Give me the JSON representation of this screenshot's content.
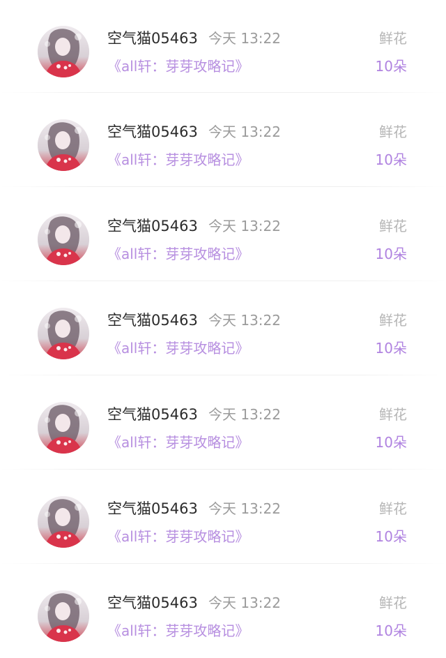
{
  "gift_records": [
    {
      "user": "空气猫05463",
      "time": "今天 13:22",
      "gift_type": "鲜花",
      "book": "《all轩：芽芽攻略记》",
      "count": "10朵"
    },
    {
      "user": "空气猫05463",
      "time": "今天 13:22",
      "gift_type": "鲜花",
      "book": "《all轩：芽芽攻略记》",
      "count": "10朵"
    },
    {
      "user": "空气猫05463",
      "time": "今天 13:22",
      "gift_type": "鲜花",
      "book": "《all轩：芽芽攻略记》",
      "count": "10朵"
    },
    {
      "user": "空气猫05463",
      "time": "今天 13:22",
      "gift_type": "鲜花",
      "book": "《all轩：芽芽攻略记》",
      "count": "10朵"
    },
    {
      "user": "空气猫05463",
      "time": "今天 13:22",
      "gift_type": "鲜花",
      "book": "《all轩：芽芽攻略记》",
      "count": "10朵"
    },
    {
      "user": "空气猫05463",
      "time": "今天 13:22",
      "gift_type": "鲜花",
      "book": "《all轩：芽芽攻略记》",
      "count": "10朵"
    },
    {
      "user": "空气猫05463",
      "time": "今天 13:22",
      "gift_type": "鲜花",
      "book": "《all轩：芽芽攻略记》",
      "count": "10朵"
    }
  ],
  "colors": {
    "name_text": "#2b2b2b",
    "time_text": "#9b9b9b",
    "gift_type_text": "#b5b5b5",
    "book_text": "#b78fe0",
    "count_text": "#b083e0"
  },
  "icons": {
    "avatar": "avatar-icon"
  }
}
